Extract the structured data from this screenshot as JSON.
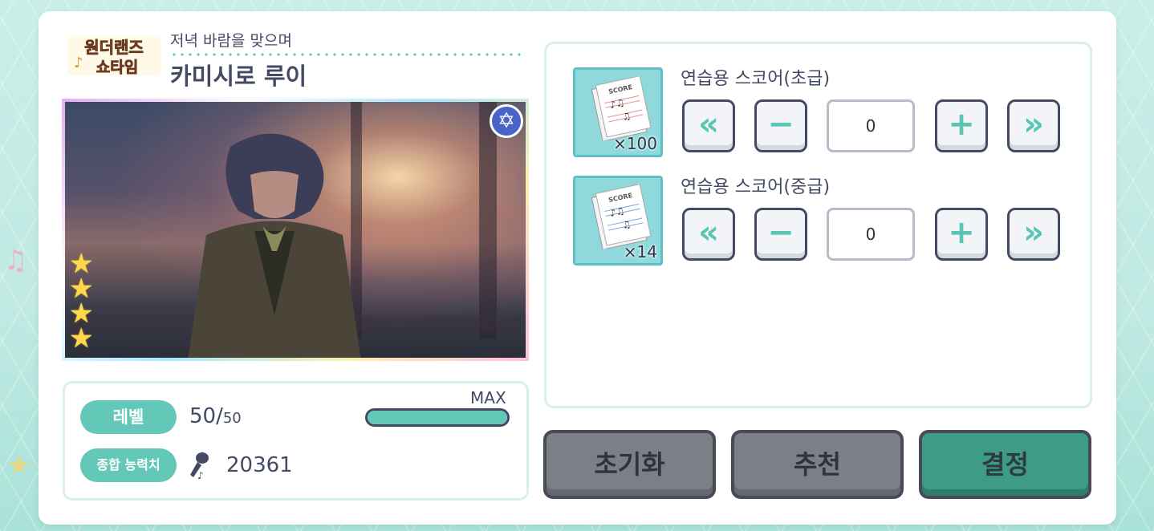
{
  "header": {
    "unit_logo_text": "원더랜즈×쇼타임",
    "card_subtitle": "저녁 바람을 맞으며",
    "character_name": "카미시로 루이"
  },
  "card": {
    "attribute_icon": "mysterious-attribute-icon",
    "rarity_stars": 4
  },
  "stats": {
    "level_label": "레벨",
    "level_current": "50/",
    "level_max": "50",
    "max_label": "MAX",
    "level_progress": 1.0,
    "power_label": "종합 능력치",
    "power_icon": "microphone-icon",
    "power_value": "20361"
  },
  "items": [
    {
      "name": "연습용 스코어(초급)",
      "count": "×100",
      "quantity": "0",
      "controls": {
        "min": "«",
        "minus": "−",
        "plus": "+",
        "max": "»"
      }
    },
    {
      "name": "연습용 스코어(중급)",
      "count": "×14",
      "quantity": "0",
      "controls": {
        "min": "«",
        "minus": "−",
        "plus": "+",
        "max": "»"
      }
    }
  ],
  "buttons": {
    "reset": "초기화",
    "recommend": "추천",
    "confirm": "결정"
  },
  "colors": {
    "accent_teal": "#64c8b8",
    "confirm_green": "#3e9c86",
    "button_gray": "#7d7f86",
    "text_dark": "#444a63",
    "attribute_blue": "#4a63c8",
    "star_yellow": "#ffd84a"
  }
}
